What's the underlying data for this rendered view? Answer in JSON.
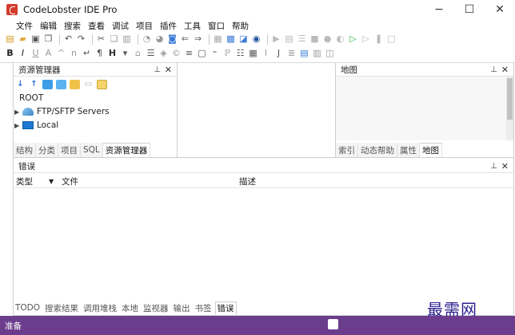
{
  "window": {
    "title": "CodeLobster IDE Pro"
  },
  "menubar": {
    "items": [
      "文件",
      "编辑",
      "搜索",
      "查看",
      "调试",
      "项目",
      "插件",
      "工具",
      "窗口",
      "帮助"
    ]
  },
  "explorer": {
    "title": "资源管理器",
    "tree": {
      "root": "ROOT",
      "items": [
        {
          "label": "FTP/SFTP Servers",
          "icon": "ftp-icon"
        },
        {
          "label": "Local",
          "icon": "local-icon"
        }
      ]
    },
    "tabs": [
      "结构",
      "分类",
      "项目",
      "SQL",
      "资源管理器"
    ],
    "active_tab": "资源管理器"
  },
  "map_panel": {
    "title": "地图",
    "tabs": [
      "索引",
      "动态帮助",
      "属性",
      "地图"
    ],
    "active_tab": "地图"
  },
  "errors_panel": {
    "title": "错误",
    "columns": {
      "type": "类型",
      "file": "文件",
      "desc": "描述"
    }
  },
  "bottom_tabs": {
    "items": [
      "TODO",
      "搜索结果",
      "调用堆栈",
      "本地",
      "监视器",
      "输出",
      "书签",
      "错误"
    ],
    "active": "错误"
  },
  "watermark": "最需网",
  "status": {
    "text": "准备"
  },
  "colors": {
    "statusbar": "#6b3d8c",
    "brand": "#d33b2c",
    "watermark": "#2b1e8c"
  }
}
